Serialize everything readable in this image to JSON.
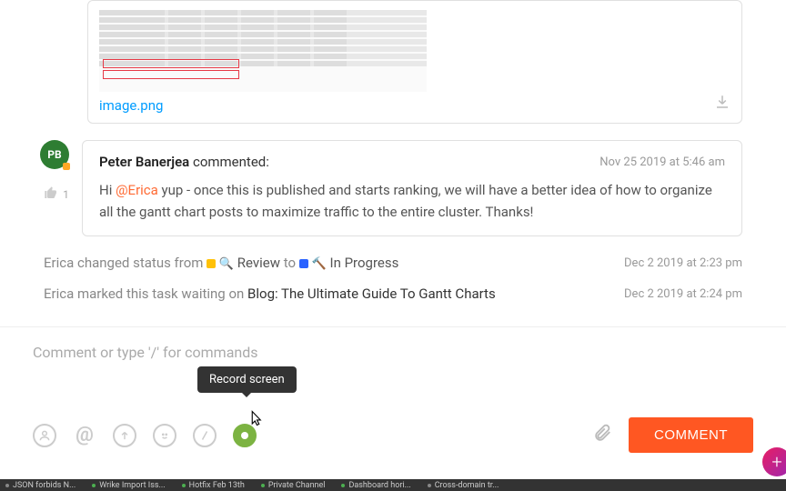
{
  "attachment": {
    "filename": "image.png"
  },
  "avatar": {
    "initials": "PB"
  },
  "like": {
    "count": "1"
  },
  "comment": {
    "author": "Peter Banerjea",
    "action": "commented:",
    "date": "Nov 25 2019 at 5:46 am",
    "hi": "Hi ",
    "mention": "@Erica",
    "body": " yup - once this is published and starts ranking, we will have a better idea of how to organize all the gantt chart posts to maximize traffic to the entire cluster. Thanks!"
  },
  "activity1": {
    "pre": "Erica changed status from ",
    "status_from": "Review",
    "to": " to ",
    "status_to": "In Progress",
    "date": "Dec 2 2019 at 2:23 pm"
  },
  "activity2": {
    "pre": "Erica marked this task waiting on ",
    "link": "Blog: The Ultimate Guide To Gantt Charts",
    "date": "Dec 2 2019 at 2:24 pm"
  },
  "composer": {
    "placeholder": "Comment or type '/' for commands",
    "tooltip": "Record screen",
    "button": "COMMENT"
  },
  "taskbar": {
    "t1": "JSON forbids N...",
    "t2": "Wrike Import Iss...",
    "t3": "Hotfix Feb 13th",
    "t4": "Private Channel",
    "t5": "Dashboard hori...",
    "t6": "Cross-domain tr..."
  }
}
